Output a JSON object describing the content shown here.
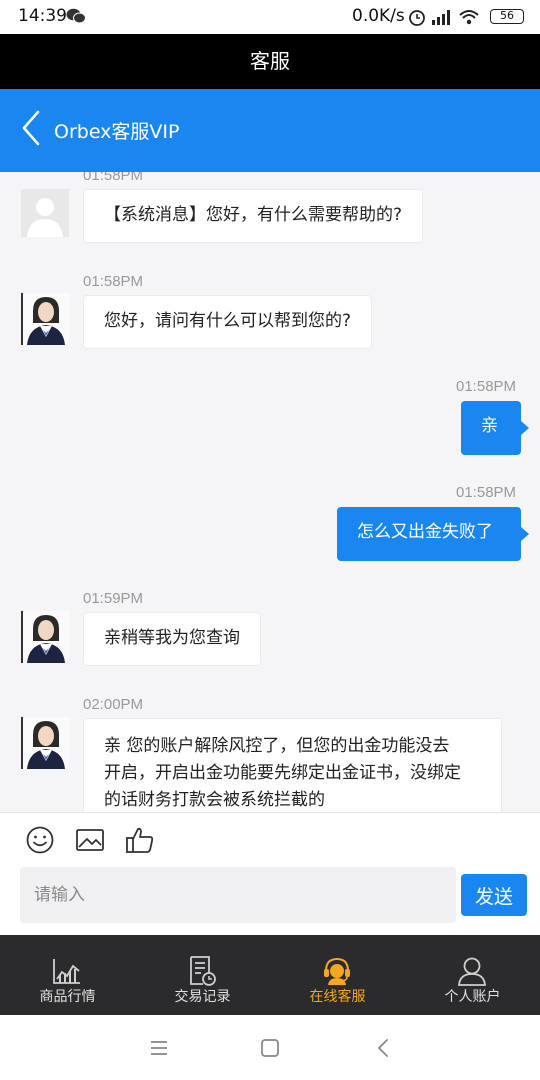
{
  "status_bar": {
    "time": "14:39",
    "network_speed": "0.0K/s",
    "battery": "56"
  },
  "app_bar": {
    "title": "客服"
  },
  "header": {
    "title": "Orbex客服VIP"
  },
  "messages": [
    {
      "side": "left",
      "time": "01:58PM",
      "avatar": "system-avatar",
      "text": "【系统消息】您好，有什么需要帮助的?"
    },
    {
      "side": "left",
      "time": "01:58PM",
      "avatar": "agent-avatar",
      "text": "您好，请问有什么可以帮到您的?"
    },
    {
      "side": "right",
      "time": "01:58PM",
      "text": "亲"
    },
    {
      "side": "right",
      "time": "01:58PM",
      "text": "怎么又出金失败了"
    },
    {
      "side": "left",
      "time": "01:59PM",
      "avatar": "agent-avatar",
      "text": "亲稍等我为您查询"
    },
    {
      "side": "left",
      "time": "02:00PM",
      "avatar": "agent-avatar",
      "lines": [
        "亲 您的账户解除风控了，但您的出金功能没去",
        "开启，开启出金功能要先绑定出金证书，没绑定",
        "的话财务打款会被系统拦截的"
      ]
    }
  ],
  "composer": {
    "placeholder": "请输入",
    "send_label": "发送",
    "tools": [
      "emoji-icon",
      "image-icon",
      "thumbs-up-icon"
    ]
  },
  "bottom_nav": {
    "items": [
      {
        "label": "商品行情",
        "icon": "market-chart-icon",
        "active": false
      },
      {
        "label": "交易记录",
        "icon": "trade-record-icon",
        "active": false
      },
      {
        "label": "在线客服",
        "icon": "customer-service-icon",
        "active": true
      },
      {
        "label": "个人账户",
        "icon": "user-account-icon",
        "active": false
      }
    ],
    "active_color": "#f5a623"
  },
  "colors": {
    "accent": "#1a86f0",
    "title_bar": "#000000",
    "nav_bg": "#2b2b2d"
  }
}
